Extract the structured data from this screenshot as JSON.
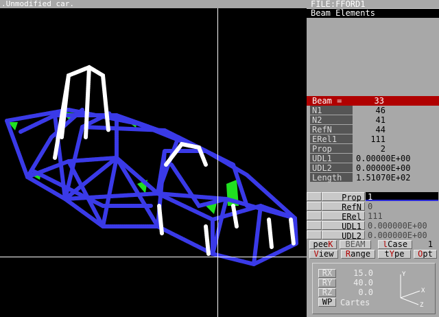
{
  "viewport": {
    "title": ".Unmodified car.",
    "colors": {
      "frame": "#3a3ae8",
      "highlight": "#ffffff",
      "panel": "#20e020"
    }
  },
  "panel": {
    "file_header": "FILE:FFORD1",
    "section_header": "Beam Elements",
    "beam": {
      "label": "Beam =",
      "value": "33"
    },
    "properties": [
      {
        "label": "N1",
        "value": "46"
      },
      {
        "label": "N2",
        "value": "41"
      },
      {
        "label": "RefN",
        "value": "44"
      },
      {
        "label": "ERel1",
        "value": "111"
      },
      {
        "label": "Prop",
        "value": "2"
      },
      {
        "label": "UDL1",
        "value": "0.00000E+00"
      },
      {
        "label": "UDL2",
        "value": "0.00000E+00"
      },
      {
        "label": "Length",
        "value": "1.51070E+02"
      }
    ],
    "edit_fields": [
      {
        "label": "Prop",
        "value": "1"
      },
      {
        "label": "RefN",
        "value": "0"
      },
      {
        "label": "ERel",
        "value": "111"
      },
      {
        "label": "UDL1",
        "value": "0.000000E+00"
      },
      {
        "label": "UDL2",
        "value": "0.000000E+00"
      }
    ],
    "commands_row1": {
      "peek_a": "pee",
      "peek_b": "K",
      "beam": "BEAM",
      "lcase_a": "l",
      "lcase_b": "Case",
      "lcase_value": "1"
    },
    "commands_row2": {
      "view_a": "V",
      "view_b": "iew",
      "range_a": "R",
      "range_b": "ange",
      "type_a": "t",
      "type_b": "Y",
      "type_c": "pe",
      "opt_a": "O",
      "opt_b": "pt"
    },
    "rotation": {
      "rx_label": "RX",
      "rx": "15.0",
      "ry_label": "RY",
      "ry": "40.0",
      "rz_label": "RZ",
      "rz": "0.0",
      "wp_label": "WP",
      "coord_system": "Cartes",
      "axis_y": "Y",
      "axis_x": "X",
      "axis_z": "Z"
    }
  }
}
